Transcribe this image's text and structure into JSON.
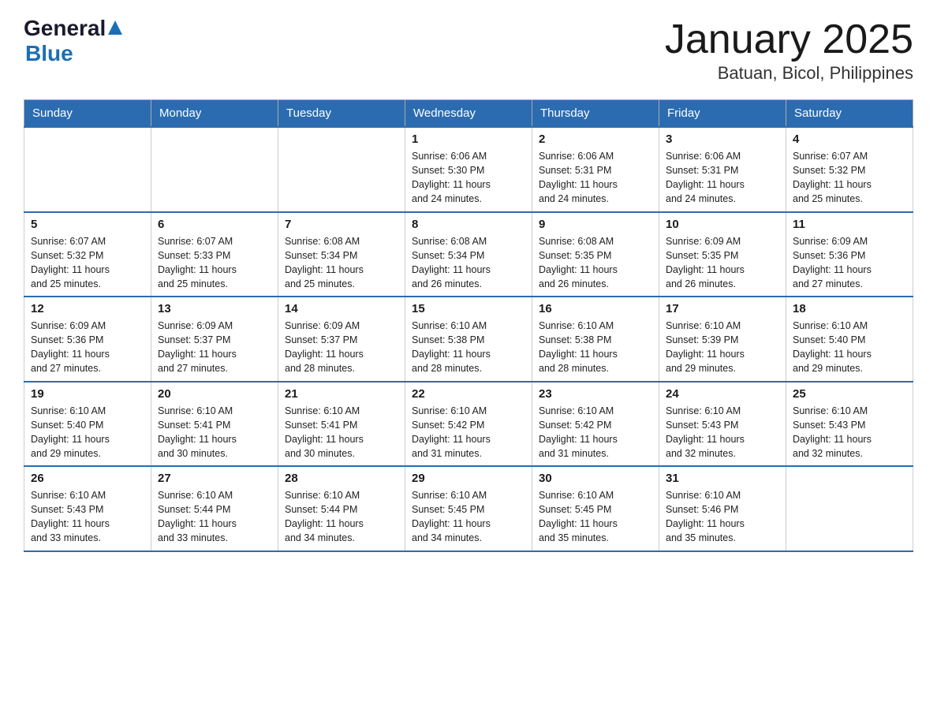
{
  "header": {
    "logo_general": "General",
    "logo_blue": "Blue",
    "title": "January 2025",
    "subtitle": "Batuan, Bicol, Philippines"
  },
  "calendar": {
    "days_of_week": [
      "Sunday",
      "Monday",
      "Tuesday",
      "Wednesday",
      "Thursday",
      "Friday",
      "Saturday"
    ],
    "weeks": [
      [
        {
          "day": "",
          "info": ""
        },
        {
          "day": "",
          "info": ""
        },
        {
          "day": "",
          "info": ""
        },
        {
          "day": "1",
          "info": "Sunrise: 6:06 AM\nSunset: 5:30 PM\nDaylight: 11 hours\nand 24 minutes."
        },
        {
          "day": "2",
          "info": "Sunrise: 6:06 AM\nSunset: 5:31 PM\nDaylight: 11 hours\nand 24 minutes."
        },
        {
          "day": "3",
          "info": "Sunrise: 6:06 AM\nSunset: 5:31 PM\nDaylight: 11 hours\nand 24 minutes."
        },
        {
          "day": "4",
          "info": "Sunrise: 6:07 AM\nSunset: 5:32 PM\nDaylight: 11 hours\nand 25 minutes."
        }
      ],
      [
        {
          "day": "5",
          "info": "Sunrise: 6:07 AM\nSunset: 5:32 PM\nDaylight: 11 hours\nand 25 minutes."
        },
        {
          "day": "6",
          "info": "Sunrise: 6:07 AM\nSunset: 5:33 PM\nDaylight: 11 hours\nand 25 minutes."
        },
        {
          "day": "7",
          "info": "Sunrise: 6:08 AM\nSunset: 5:34 PM\nDaylight: 11 hours\nand 25 minutes."
        },
        {
          "day": "8",
          "info": "Sunrise: 6:08 AM\nSunset: 5:34 PM\nDaylight: 11 hours\nand 26 minutes."
        },
        {
          "day": "9",
          "info": "Sunrise: 6:08 AM\nSunset: 5:35 PM\nDaylight: 11 hours\nand 26 minutes."
        },
        {
          "day": "10",
          "info": "Sunrise: 6:09 AM\nSunset: 5:35 PM\nDaylight: 11 hours\nand 26 minutes."
        },
        {
          "day": "11",
          "info": "Sunrise: 6:09 AM\nSunset: 5:36 PM\nDaylight: 11 hours\nand 27 minutes."
        }
      ],
      [
        {
          "day": "12",
          "info": "Sunrise: 6:09 AM\nSunset: 5:36 PM\nDaylight: 11 hours\nand 27 minutes."
        },
        {
          "day": "13",
          "info": "Sunrise: 6:09 AM\nSunset: 5:37 PM\nDaylight: 11 hours\nand 27 minutes."
        },
        {
          "day": "14",
          "info": "Sunrise: 6:09 AM\nSunset: 5:37 PM\nDaylight: 11 hours\nand 28 minutes."
        },
        {
          "day": "15",
          "info": "Sunrise: 6:10 AM\nSunset: 5:38 PM\nDaylight: 11 hours\nand 28 minutes."
        },
        {
          "day": "16",
          "info": "Sunrise: 6:10 AM\nSunset: 5:38 PM\nDaylight: 11 hours\nand 28 minutes."
        },
        {
          "day": "17",
          "info": "Sunrise: 6:10 AM\nSunset: 5:39 PM\nDaylight: 11 hours\nand 29 minutes."
        },
        {
          "day": "18",
          "info": "Sunrise: 6:10 AM\nSunset: 5:40 PM\nDaylight: 11 hours\nand 29 minutes."
        }
      ],
      [
        {
          "day": "19",
          "info": "Sunrise: 6:10 AM\nSunset: 5:40 PM\nDaylight: 11 hours\nand 29 minutes."
        },
        {
          "day": "20",
          "info": "Sunrise: 6:10 AM\nSunset: 5:41 PM\nDaylight: 11 hours\nand 30 minutes."
        },
        {
          "day": "21",
          "info": "Sunrise: 6:10 AM\nSunset: 5:41 PM\nDaylight: 11 hours\nand 30 minutes."
        },
        {
          "day": "22",
          "info": "Sunrise: 6:10 AM\nSunset: 5:42 PM\nDaylight: 11 hours\nand 31 minutes."
        },
        {
          "day": "23",
          "info": "Sunrise: 6:10 AM\nSunset: 5:42 PM\nDaylight: 11 hours\nand 31 minutes."
        },
        {
          "day": "24",
          "info": "Sunrise: 6:10 AM\nSunset: 5:43 PM\nDaylight: 11 hours\nand 32 minutes."
        },
        {
          "day": "25",
          "info": "Sunrise: 6:10 AM\nSunset: 5:43 PM\nDaylight: 11 hours\nand 32 minutes."
        }
      ],
      [
        {
          "day": "26",
          "info": "Sunrise: 6:10 AM\nSunset: 5:43 PM\nDaylight: 11 hours\nand 33 minutes."
        },
        {
          "day": "27",
          "info": "Sunrise: 6:10 AM\nSunset: 5:44 PM\nDaylight: 11 hours\nand 33 minutes."
        },
        {
          "day": "28",
          "info": "Sunrise: 6:10 AM\nSunset: 5:44 PM\nDaylight: 11 hours\nand 34 minutes."
        },
        {
          "day": "29",
          "info": "Sunrise: 6:10 AM\nSunset: 5:45 PM\nDaylight: 11 hours\nand 34 minutes."
        },
        {
          "day": "30",
          "info": "Sunrise: 6:10 AM\nSunset: 5:45 PM\nDaylight: 11 hours\nand 35 minutes."
        },
        {
          "day": "31",
          "info": "Sunrise: 6:10 AM\nSunset: 5:46 PM\nDaylight: 11 hours\nand 35 minutes."
        },
        {
          "day": "",
          "info": ""
        }
      ]
    ]
  }
}
